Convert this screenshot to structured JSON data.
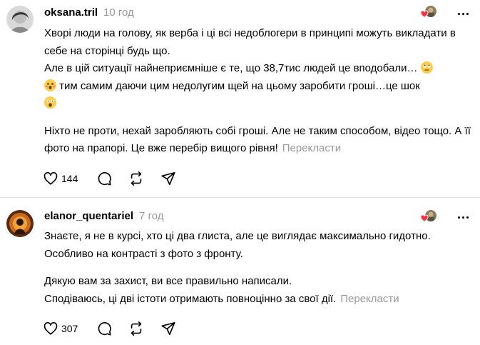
{
  "comments": [
    {
      "username": "oksana.tril",
      "time": "10 год",
      "paragraphs": [
        "Хворі люди на голову, як верба і ці всі недоблогери в принципі можуть викладати в себе на сторінці будь що.",
        "Але в цій ситуації найнеприємніше є те, що 38,7тис людей це вподобали…",
        "тим самим даючи цим недолугим щей на цьому заробити гроші…це шок",
        "Ніхто не проти, нехай заробляють собі гроші. Але не таким способом, відео тощо. А її фото на прапорі. Це вже перебір вищого рівня!"
      ],
      "translate": "Перекласти",
      "likes": "144"
    },
    {
      "username": "elanor_quentariel",
      "time": "7 год",
      "paragraphs": [
        "Знаєте, я не в курсі, хто ці два глиста, але це виглядає максимально гидотно. Особливо на контрасті з фото з фронту.",
        "Дякую вам за захист, ви все правильно написали.",
        "Сподіваюсь, ці дві істоти отримають повноцінно за свої дії."
      ],
      "translate": "Перекласти",
      "likes": "307"
    }
  ],
  "icons": {
    "like": "heart-outline-icon",
    "reply": "speech-bubble-icon",
    "repost": "repost-arrows-icon",
    "share": "paper-plane-icon",
    "more": "more-horizontal-icon",
    "liked_by_author": "heart-filled-icon"
  },
  "colors": {
    "text": "#000000",
    "muted": "#999999",
    "divider": "#e5e5e5",
    "heart": "#ff3040"
  }
}
